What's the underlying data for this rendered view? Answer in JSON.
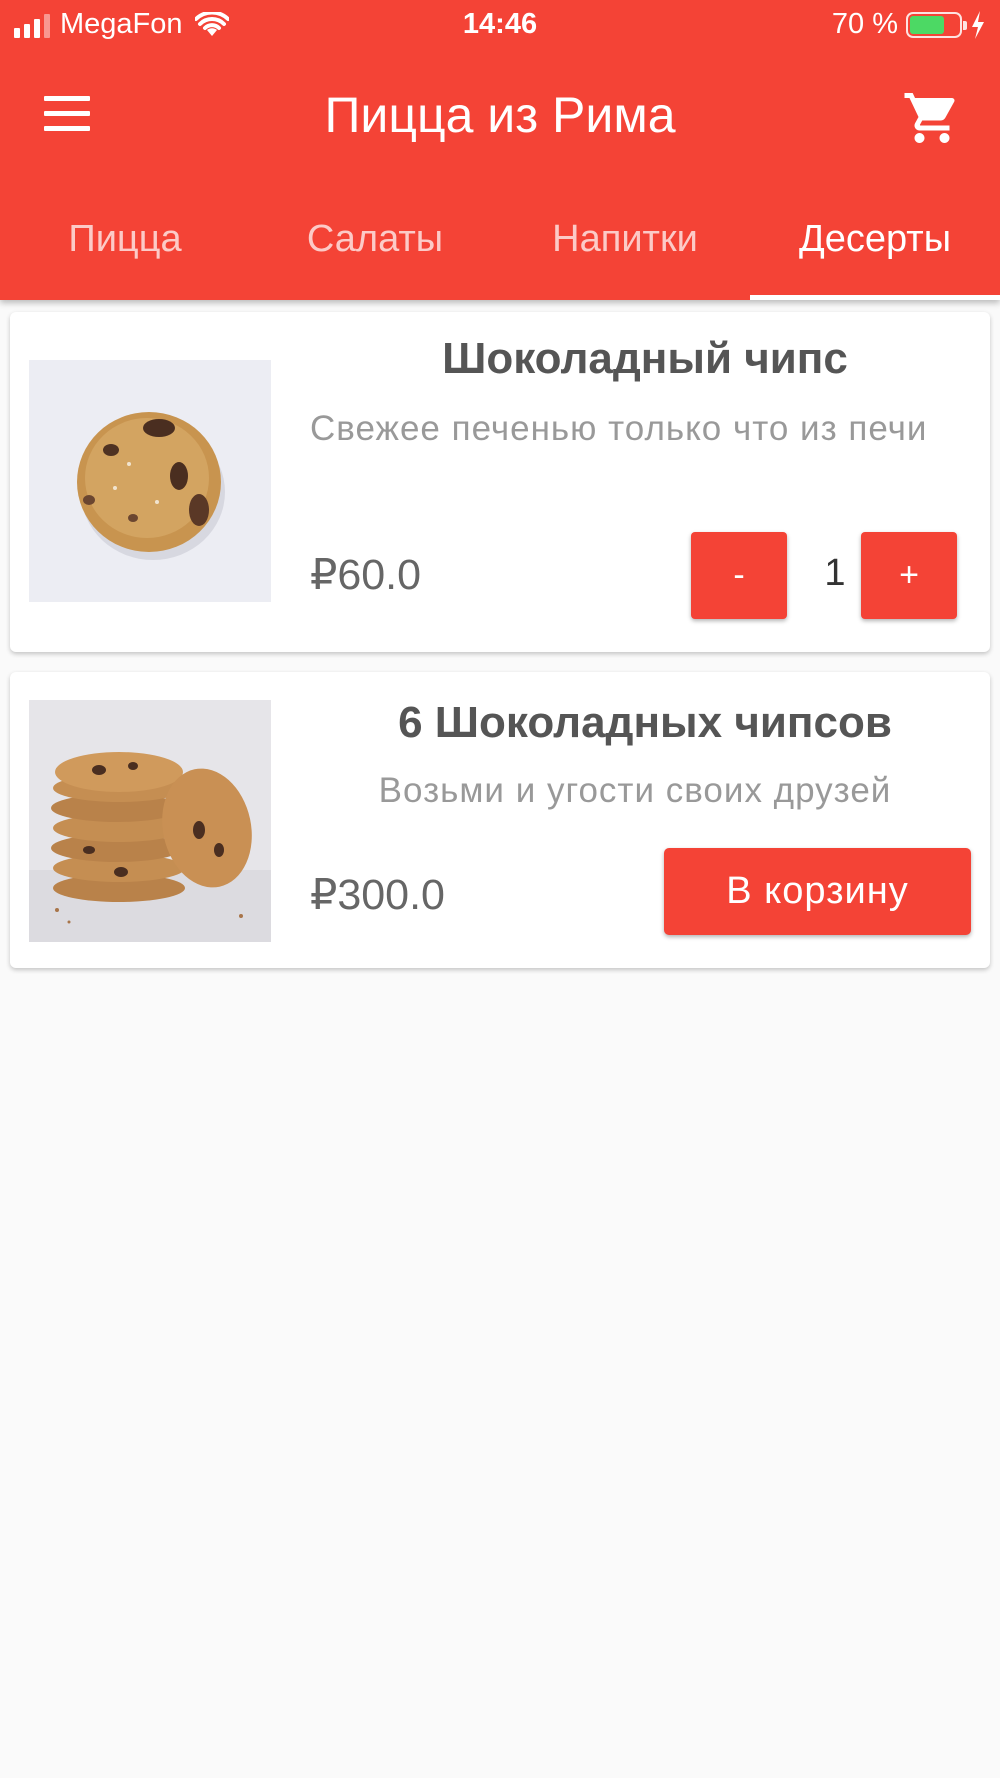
{
  "status_bar": {
    "carrier": "MegaFon",
    "time": "14:46",
    "battery_text": "70 %",
    "battery_level": 0.7
  },
  "app": {
    "title": "Пицца из Рима",
    "menu_icon": "hamburger-menu-icon",
    "cart_icon": "shopping-cart-icon",
    "accent_color": "#f44336"
  },
  "tabs": [
    {
      "label": "Пицца",
      "active": false
    },
    {
      "label": "Салаты",
      "active": false
    },
    {
      "label": "Напитки",
      "active": false
    },
    {
      "label": "Десерты",
      "active": true
    }
  ],
  "products": [
    {
      "name": "Шоколадный чипс",
      "description": "Свежее печенью только что из печи",
      "price": "₽60.0",
      "quantity": "1",
      "minus_label": "-",
      "plus_label": "+"
    },
    {
      "name": "6 Шоколадных чипсов",
      "description": "Возьми и угости своих друзей",
      "price": "₽300.0",
      "add_label": "В корзину"
    }
  ]
}
